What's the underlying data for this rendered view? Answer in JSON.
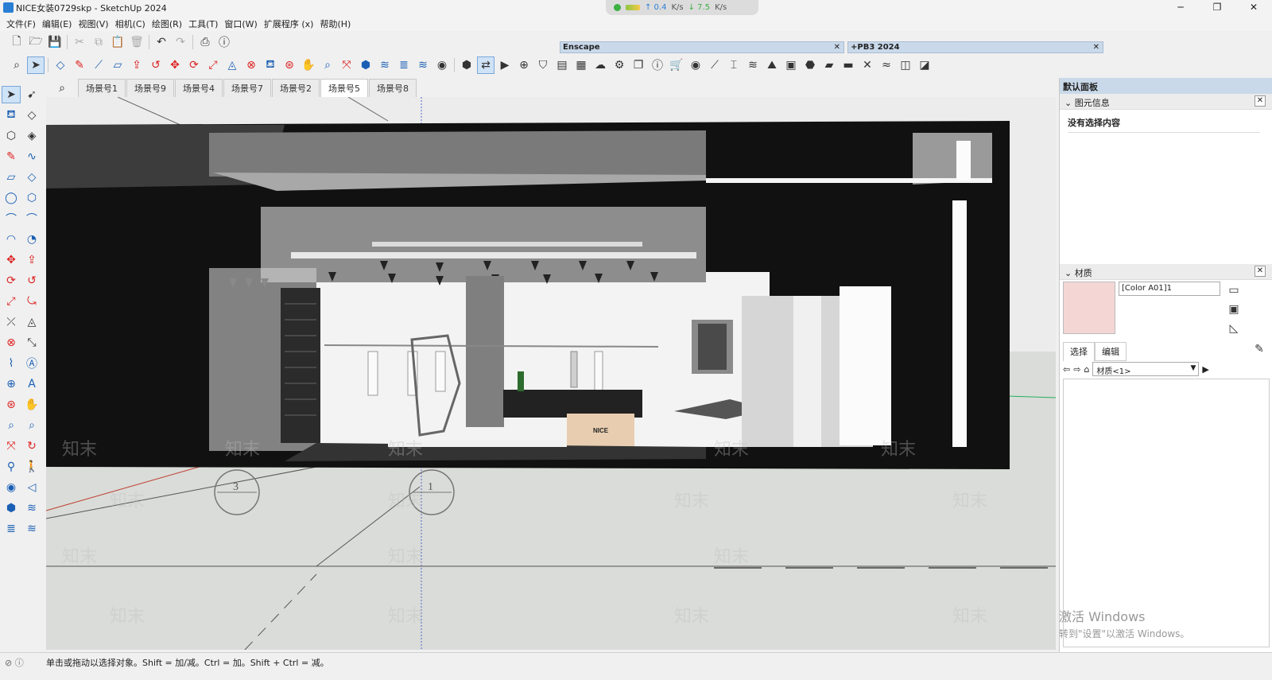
{
  "window": {
    "title": "NICE女装0729skp - SketchUp 2024",
    "minimize": "─",
    "maximize": "❐",
    "close": "✕"
  },
  "netmon": {
    "up": "↑ 0.4",
    "up_unit": "K/s",
    "down": "↓ 7.5",
    "down_unit": "K/s"
  },
  "menu": [
    "文件(F)",
    "编辑(E)",
    "视图(V)",
    "相机(C)",
    "绘图(R)",
    "工具(T)",
    "窗口(W)",
    "扩展程序 (x)",
    "帮助(H)"
  ],
  "ext_panels": {
    "enscape": "Enscape",
    "pb3": "+PB3 2024",
    "close": "✕"
  },
  "scene_tabs": [
    "场景号1",
    "场景号9",
    "场景号4",
    "场景号7",
    "场景号2",
    "场景号5",
    "场景号8"
  ],
  "active_scene": "场景号5",
  "scene_search_icon": "⌕",
  "viewport": {
    "sign_text": "NICE",
    "marker_3": "3",
    "marker_1": "1",
    "watermark": "知末"
  },
  "tray": {
    "title": "默认面板",
    "entity_info": {
      "heading": "图元信息",
      "empty": "没有选择内容"
    },
    "materials": {
      "heading": "材质",
      "name": "[Color A01]1",
      "tab_select": "选择",
      "tab_edit": "编辑",
      "library": "材质<1>",
      "swatch_color": "#f4d7d5"
    }
  },
  "activate": {
    "line1": "激活 Windows",
    "line2": "转到\"设置\"以激活 Windows。"
  },
  "status": {
    "text": "单击或拖动以选择对象。Shift = 加/减。Ctrl = 加。Shift + Ctrl = 减。"
  }
}
